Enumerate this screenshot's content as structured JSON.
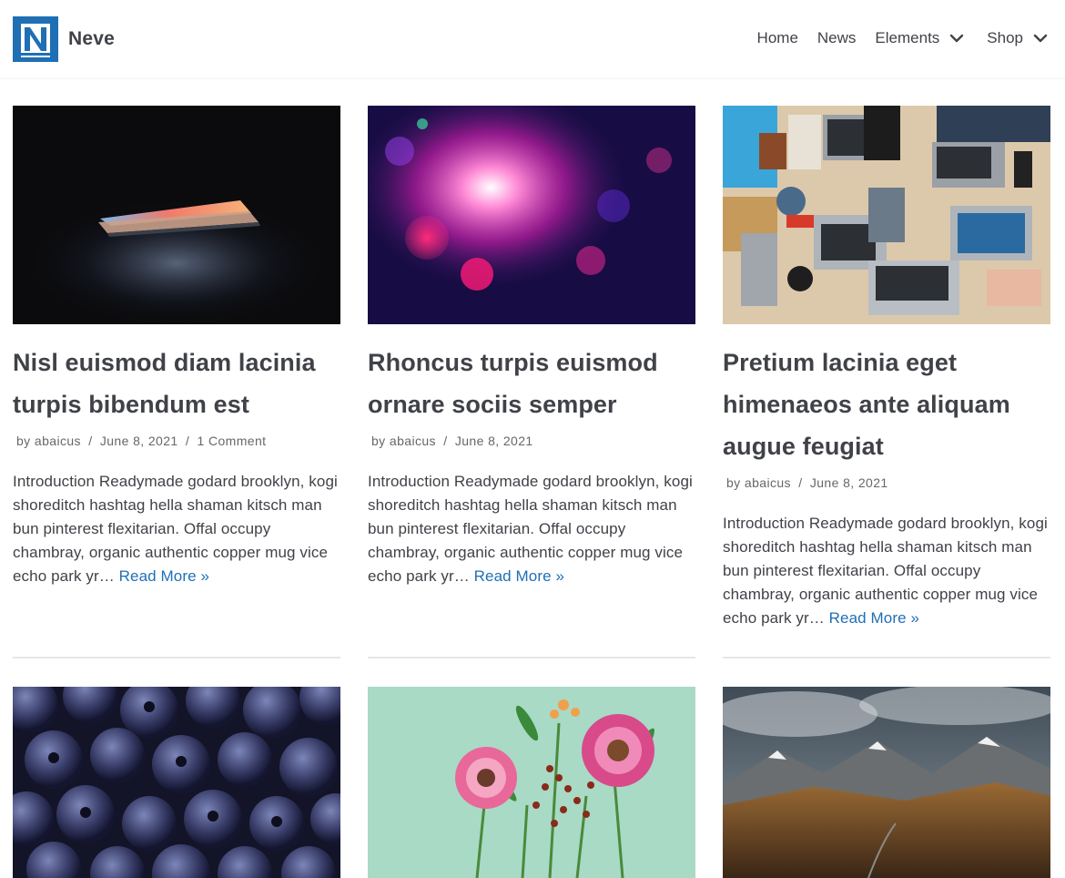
{
  "site": {
    "logo_letter": "N",
    "name": "Neve",
    "accent": "#1f6fb5"
  },
  "nav": {
    "items": [
      {
        "label": "Home"
      },
      {
        "label": "News"
      },
      {
        "label": "Elements"
      },
      {
        "label": "Shop"
      }
    ]
  },
  "posts": [
    {
      "title": "Nisl euismod diam lacinia turpis bibendum est",
      "author_prefix": "by",
      "author": "abaicus",
      "date": "June 8, 2021",
      "comments": "1 Comment",
      "excerpt": "Introduction Readymade godard brooklyn, kogi shoreditch hashtag hella shaman kitsch man bun pinterest flexitarian. Offal occupy chambray, organic authentic copper mug vice echo park yr…",
      "read_more": "Read More »"
    },
    {
      "title": "Rhoncus turpis euismod ornare sociis semper",
      "author_prefix": "by",
      "author": "abaicus",
      "date": "June 8, 2021",
      "excerpt": "Introduction Readymade godard brooklyn, kogi shoreditch hashtag hella shaman kitsch man bun pinterest flexitarian. Offal occupy chambray, organic authentic copper mug vice echo park yr…",
      "read_more": "Read More »"
    },
    {
      "title": "Pretium lacinia eget himenaeos ante aliquam augue feugiat",
      "author_prefix": "by",
      "author": "abaicus",
      "date": "June 8, 2021",
      "excerpt": "Introduction Readymade godard brooklyn, kogi shoreditch hashtag hella shaman kitsch man bun pinterest flexitarian. Offal occupy chambray, organic authentic copper mug vice echo park yr…",
      "read_more": "Read More »"
    }
  ]
}
